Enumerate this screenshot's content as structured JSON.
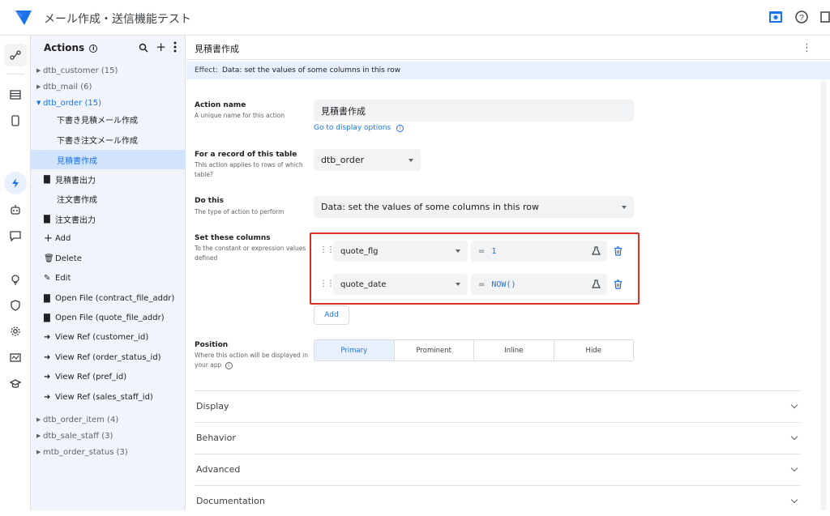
{
  "app": {
    "title": "メール作成・送信機能テスト",
    "colors": {
      "brand": "#1a73e8",
      "highlight": "#d93025"
    },
    "top_icons": [
      "preview-icon",
      "help-icon",
      "copy-icon"
    ]
  },
  "rail": {
    "icons": [
      "flow-icon",
      "table-icon",
      "phone-icon",
      "bolt-icon",
      "robot-icon",
      "chat-icon",
      "bulb-icon",
      "shield-icon",
      "gear-icon",
      "monitor-icon",
      "cap-icon"
    ]
  },
  "sidebar": {
    "title": "Actions",
    "tables": [
      {
        "label": "dtb_customer (15)"
      },
      {
        "label": "dtb_mail (6)"
      },
      {
        "label": "dtb_order (15)"
      }
    ],
    "actions": [
      {
        "label": "下書き見積メール作成"
      },
      {
        "label": "下書き注文メール作成"
      },
      {
        "label": "見積書作成"
      },
      {
        "label": "見積書出力"
      },
      {
        "label": "注文書作成"
      },
      {
        "label": "注文書出力"
      },
      {
        "label": "Add"
      },
      {
        "label": "Delete"
      },
      {
        "label": "Edit"
      },
      {
        "label": "Open File (contract_file_addr)"
      },
      {
        "label": "Open File (quote_file_addr)"
      },
      {
        "label": "View Ref (customer_id)"
      },
      {
        "label": "View Ref (order_status_id)"
      },
      {
        "label": "View Ref (pref_id)"
      },
      {
        "label": "View Ref (sales_staff_id)"
      }
    ],
    "tables_after": [
      {
        "label": "dtb_order_item (4)"
      },
      {
        "label": "dtb_sale_staff (3)"
      },
      {
        "label": "mtb_order_status (3)"
      }
    ]
  },
  "main": {
    "title": "見積書作成",
    "effect_label": "Effect:",
    "effect_value": "Data: set the values of some columns in this row",
    "action_name": {
      "label": "Action name",
      "help": "A unique name for this action",
      "value": "見積書作成",
      "link": "Go to display options"
    },
    "record": {
      "label": "For a record of this table",
      "help": "This action applies to rows of which table?",
      "value": "dtb_order"
    },
    "do_this": {
      "label": "Do this",
      "help": "The type of action to perform",
      "value": "Data: set the values of some columns in this row"
    },
    "set_columns": {
      "label": "Set these columns",
      "help": "To the constant or expression values defined",
      "rows": [
        {
          "column": "quote_flg",
          "eq": "=",
          "expr": "1"
        },
        {
          "column": "quote_date",
          "eq": "=",
          "expr": "NOW()"
        }
      ],
      "add_label": "Add"
    },
    "position": {
      "label": "Position",
      "help": "Where this action will be displayed in your app",
      "options": [
        "Primary",
        "Prominent",
        "Inline",
        "Hide"
      ],
      "selected": "Primary"
    },
    "sections": [
      "Display",
      "Behavior",
      "Advanced",
      "Documentation"
    ]
  }
}
